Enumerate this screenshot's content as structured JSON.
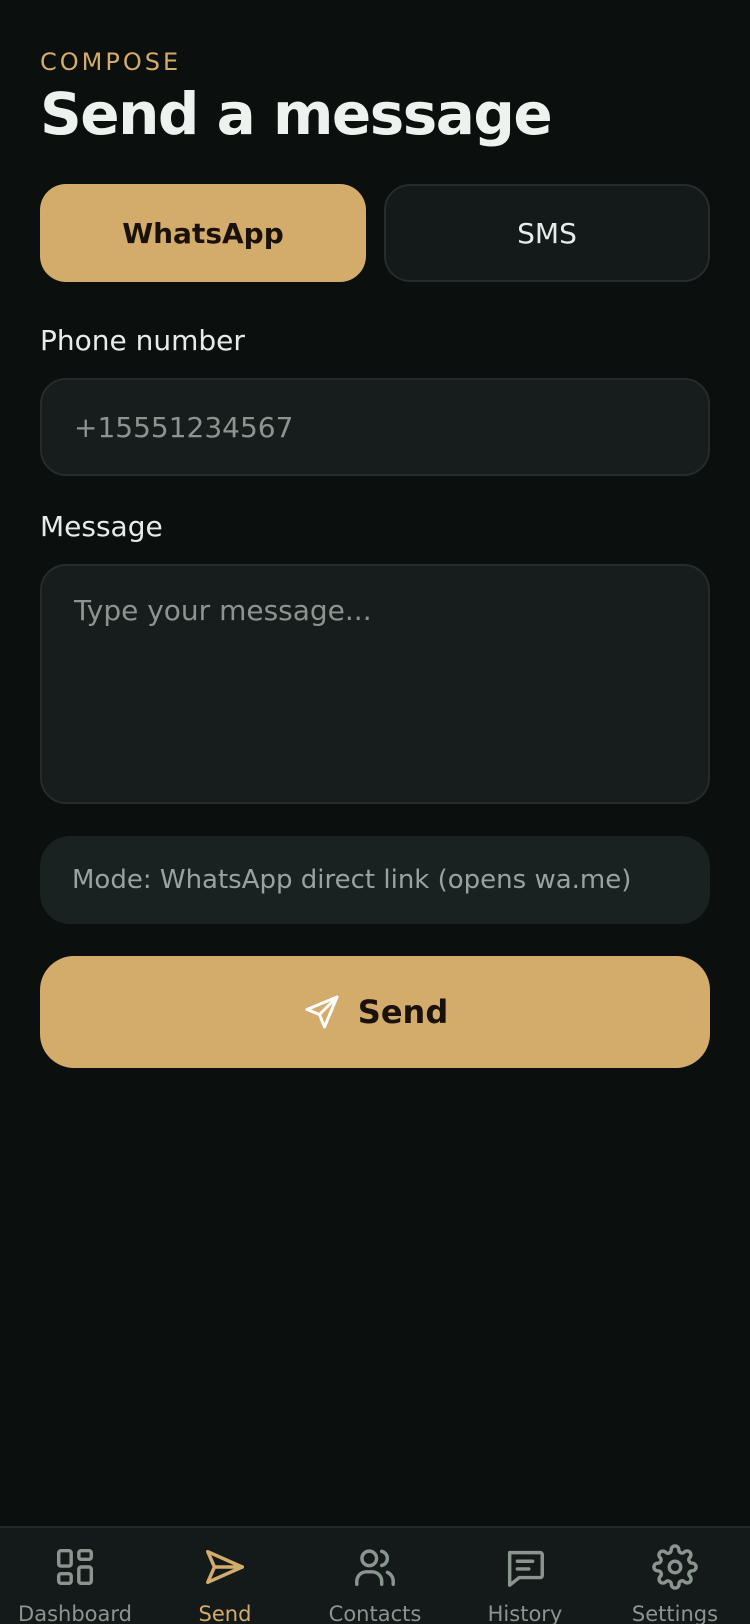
{
  "header": {
    "eyebrow": "COMPOSE",
    "title": "Send a message"
  },
  "channel": {
    "options": [
      {
        "label": "WhatsApp",
        "selected": true
      },
      {
        "label": "SMS",
        "selected": false
      }
    ]
  },
  "form": {
    "phone_label": "Phone number",
    "phone_placeholder": "+15551234567",
    "message_label": "Message",
    "message_placeholder": "Type your message..."
  },
  "mode_text": "Mode: WhatsApp direct link (opens wa.me)",
  "send_button": {
    "label": "Send",
    "icon": "send-icon"
  },
  "nav": {
    "items": [
      {
        "label": "Dashboard",
        "icon": "dashboard-icon",
        "active": false
      },
      {
        "label": "Send",
        "icon": "send-icon",
        "active": true
      },
      {
        "label": "Contacts",
        "icon": "contacts-icon",
        "active": false
      },
      {
        "label": "History",
        "icon": "history-icon",
        "active": false
      },
      {
        "label": "Settings",
        "icon": "gear-icon",
        "active": false
      }
    ]
  },
  "colors": {
    "background": "#0b0f0e",
    "accent": "#d3ab6a",
    "surface": "#161d1c",
    "muted_text": "#8a9590"
  }
}
